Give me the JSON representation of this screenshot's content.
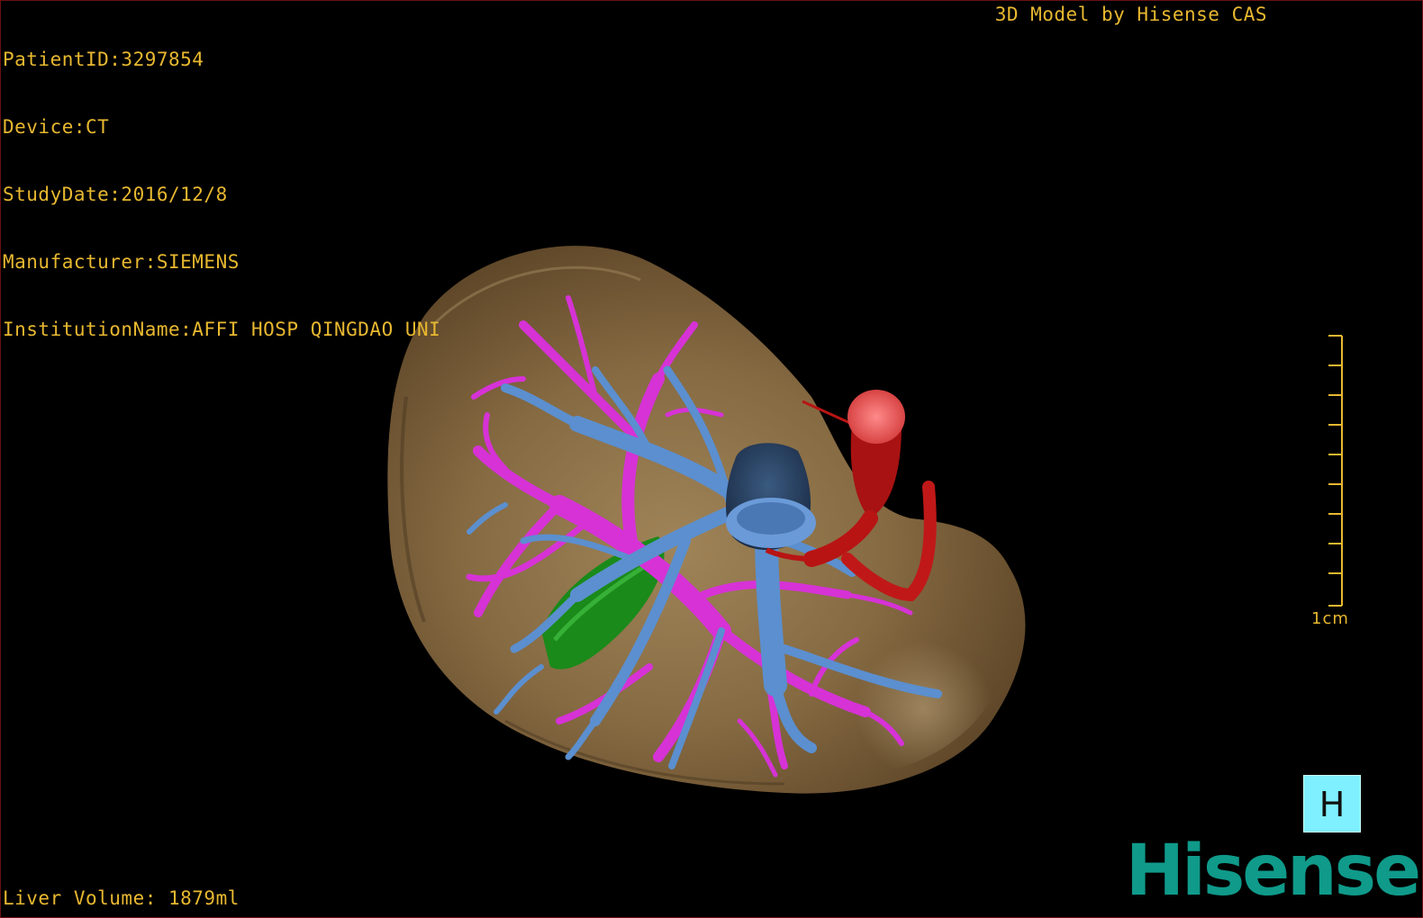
{
  "viewer": {
    "info": {
      "patient_id": "PatientID:3297854",
      "device": "Device:CT",
      "study_date": "StudyDate:2016/12/8",
      "manufacturer": "Manufacturer:SIEMENS",
      "institution": "InstitutionName:AFFI HOSP QINGDAO UNI"
    },
    "vendor_label": "3D Model by Hisense CAS",
    "volume_label": "Liver Volume: 1879ml",
    "scale_label": "1cm",
    "view_button_label": "H",
    "brand": "Hisense"
  },
  "colors": {
    "overlay_text": "#e8b830",
    "liver": "#7a5e3a",
    "portal_vein": "#d632d6",
    "hepatic_vein": "#5b8fcf",
    "artery": "#b81414",
    "bile": "#1a8a1a",
    "brand": "#0f9a8a",
    "button_bg": "#7ff0ff"
  },
  "icons": {
    "view_button": "anterior-view-icon"
  }
}
